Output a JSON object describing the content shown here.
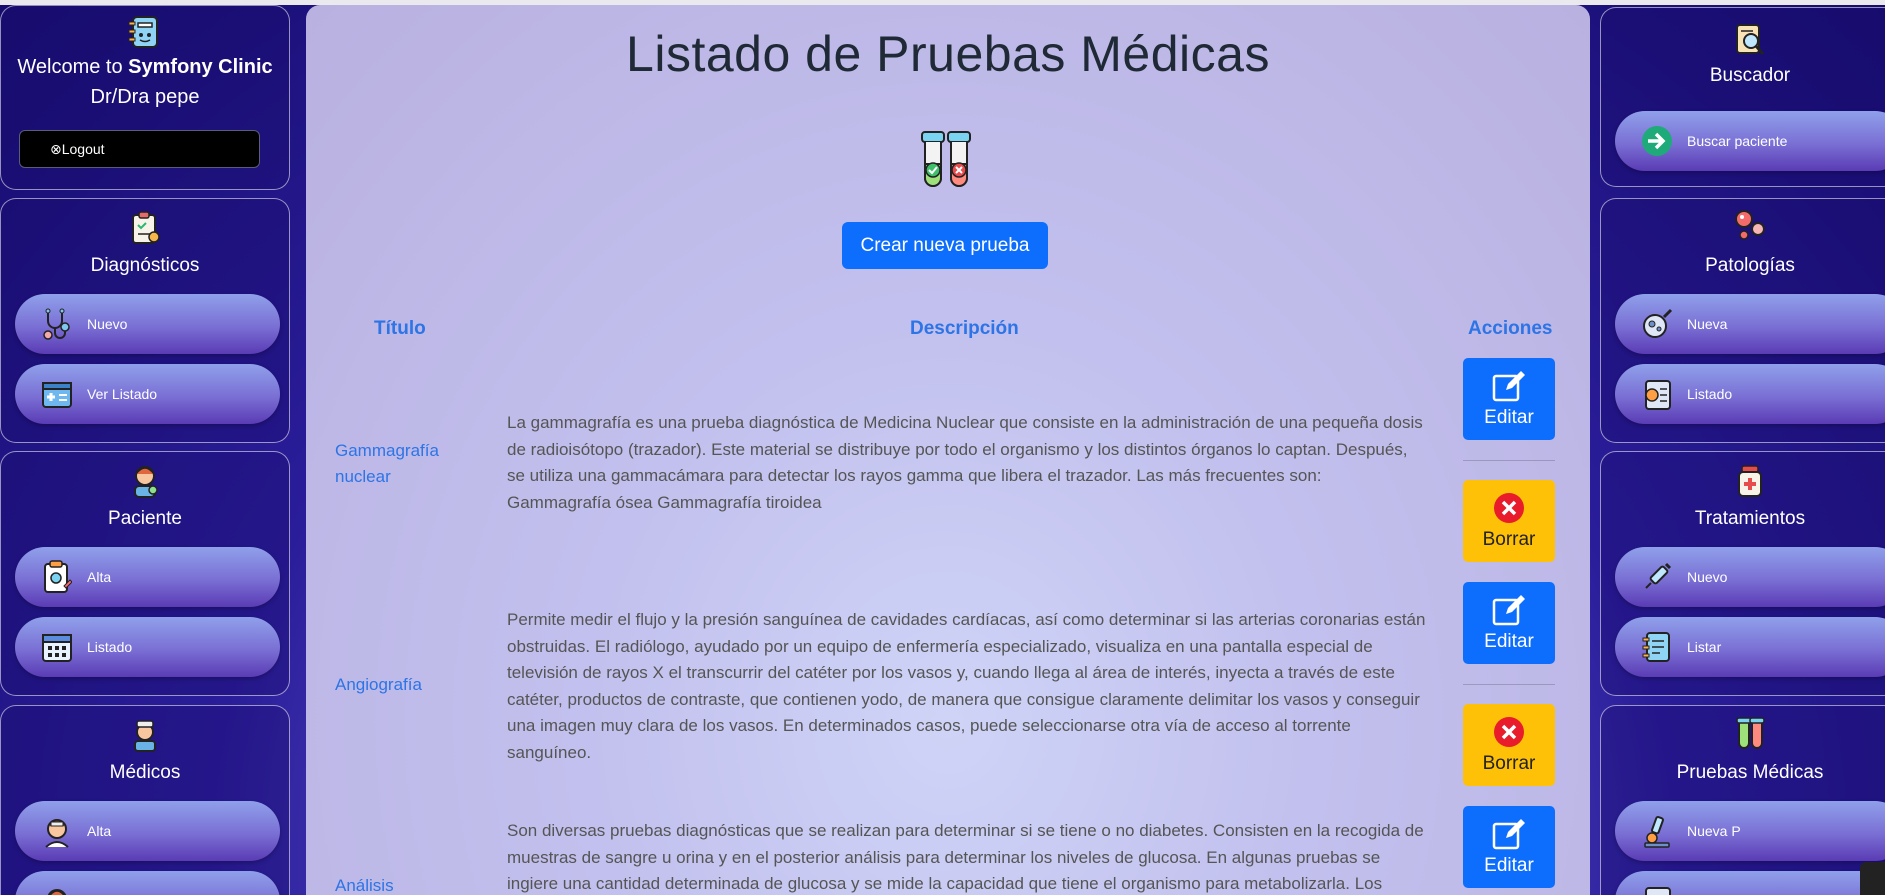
{
  "left": {
    "welcome": {
      "prefix": "Welcome to",
      "brand": "Symfony Clinic",
      "suffix": "Dr/Dra pepe",
      "logout": "⊗Logout"
    },
    "diagnosticos": {
      "title": "Diagnósticos",
      "items": [
        {
          "label": "Nuevo",
          "icon": "stethoscope-icon"
        },
        {
          "label": "Ver Listado",
          "icon": "medical-card-icon"
        }
      ]
    },
    "paciente": {
      "title": "Paciente",
      "items": [
        {
          "label": "Alta",
          "icon": "clipboard-icon"
        },
        {
          "label": "Listado",
          "icon": "calendar-icon"
        }
      ]
    },
    "medicos": {
      "title": "Médicos",
      "items": [
        {
          "label": "Alta",
          "icon": "doctor-icon"
        }
      ]
    }
  },
  "right": {
    "buscador": {
      "title": "Buscador",
      "items": [
        {
          "label": "Buscar paciente",
          "icon": "arrow-right-icon"
        }
      ]
    },
    "patologias": {
      "title": "Patologías",
      "items": [
        {
          "label": "Nueva",
          "icon": "virus-icon"
        },
        {
          "label": "Listado",
          "icon": "list-icon"
        }
      ]
    },
    "tratamientos": {
      "title": "Tratamientos",
      "items": [
        {
          "label": "Nuevo",
          "icon": "syringe-icon"
        },
        {
          "label": "Listar",
          "icon": "notebook-icon"
        }
      ]
    },
    "pruebas": {
      "title": "Pruebas Médicas",
      "items": [
        {
          "label": "Nueva P",
          "icon": "microscope-icon"
        }
      ]
    }
  },
  "main": {
    "title": "Listado de Pruebas Médicas",
    "create_button": "Crear nueva prueba",
    "columns": {
      "title": "Título",
      "description": "Descripción",
      "actions": "Acciones"
    },
    "edit_label": "Editar",
    "delete_label": "Borrar",
    "rows": [
      {
        "title": "Gammagrafía nuclear",
        "description": "La gammagrafía es una prueba diagnóstica de Medicina Nuclear que consiste en la administración de una pequeña dosis de radioisótopo (trazador). Este material se distribuye por todo el organismo y los distintos órganos lo captan. Después, se utiliza una gammacámara para detectar los rayos gamma que libera el trazador. Las más frecuentes son: Gammagrafía ósea Gammagrafía tiroidea"
      },
      {
        "title": "Angiografía",
        "description": "Permite medir el flujo y la presión sanguínea de cavidades cardíacas, así como determinar si las arterias coronarias están obstruidas. El radiólogo, ayudado por un equipo de enfermería especializado, visualiza en una pantalla especial de televisión de rayos X el transcurrir del catéter por los vasos y, cuando llega al área de interés, inyecta a través de este catéter, productos de contraste, que contienen yodo, de manera que consigue claramente delimitar los vasos y conseguir una imagen muy clara de los vasos. En determinados casos, puede seleccionarse otra vía de acceso al torrente sanguíneo."
      },
      {
        "title": "Análisis",
        "description": "Son diversas pruebas diagnósticas que se realizan para determinar si se tiene o no diabetes. Consisten en la recogida de muestras de sangre u orina y en el posterior análisis para determinar los niveles de glucosa. En algunas pruebas se ingiere una cantidad determinada de glucosa y se mide la capacidad que tiene el organismo para metabolizarla. Los"
      }
    ]
  }
}
